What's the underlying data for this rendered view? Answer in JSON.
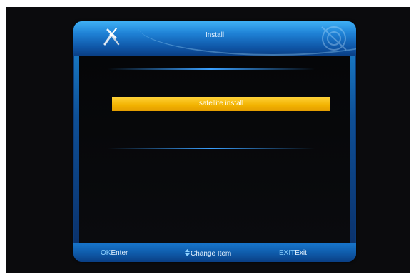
{
  "window": {
    "title": "Install"
  },
  "menu": {
    "items": [
      {
        "label": "satellite install",
        "selected": true
      }
    ]
  },
  "footer": {
    "hints": [
      {
        "key": "OK",
        "action": "Enter"
      },
      {
        "key": "",
        "icon": "up-down-arrows-icon",
        "action": "Change Item"
      },
      {
        "key": "EXIT",
        "action": "Exit"
      }
    ]
  },
  "colors": {
    "frame": "#1f82d6",
    "highlight": "#f2b200",
    "background": "#0b0b0d"
  }
}
